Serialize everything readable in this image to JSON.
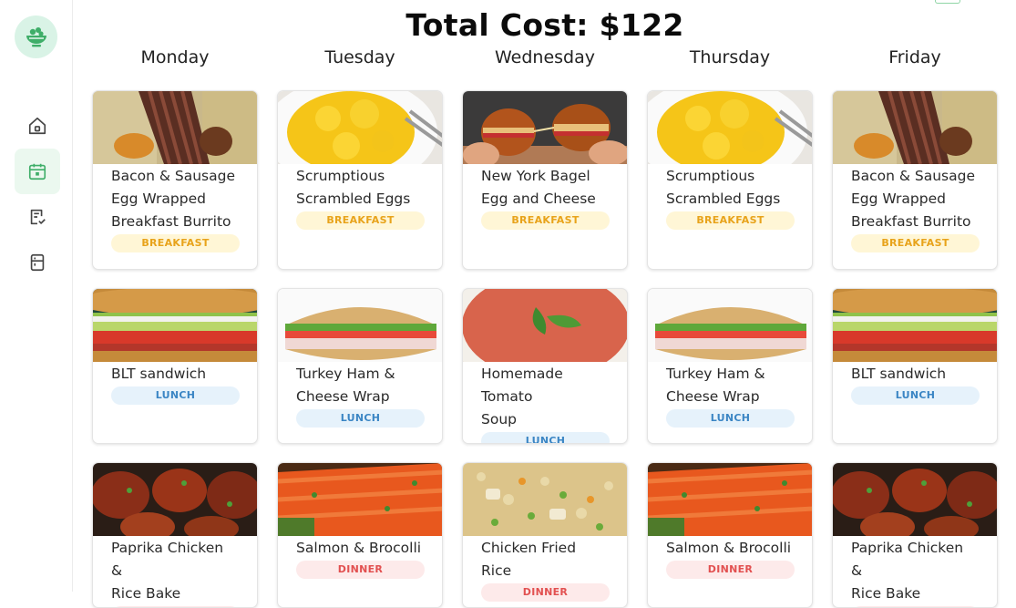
{
  "app": {
    "logo_icon": "salad-bowl-icon",
    "nav": [
      {
        "icon": "home-icon",
        "active": false
      },
      {
        "icon": "calendar-icon",
        "active": true
      },
      {
        "icon": "checklist-icon",
        "active": false
      },
      {
        "icon": "fridge-icon",
        "active": false
      }
    ]
  },
  "header": {
    "total_cost": "Total Cost: $122"
  },
  "days": [
    "Monday",
    "Tuesday",
    "Wednesday",
    "Thursday",
    "Friday"
  ],
  "meals": {
    "breakfast": [
      {
        "title_lines": [
          "Bacon & Sausage",
          "Egg Wrapped",
          "Breakfast Burrito"
        ],
        "badge": "BREAKFAST",
        "image": "burrito-image"
      },
      {
        "title_lines": [
          "Scrumptious",
          "Scrambled Eggs"
        ],
        "badge": "BREAKFAST",
        "image": "scrambled-eggs-image"
      },
      {
        "title_lines": [
          "New York Bagel",
          "Egg and Cheese"
        ],
        "badge": "BREAKFAST",
        "image": "bagel-image"
      },
      {
        "title_lines": [
          "Scrumptious",
          "Scrambled Eggs"
        ],
        "badge": "BREAKFAST",
        "image": "scrambled-eggs-image"
      },
      {
        "title_lines": [
          "Bacon & Sausage",
          "Egg Wrapped",
          "Breakfast Burrito"
        ],
        "badge": "BREAKFAST",
        "image": "burrito-image"
      }
    ],
    "lunch": [
      {
        "title_lines": [
          "BLT sandwich"
        ],
        "badge": "LUNCH",
        "image": "blt-image"
      },
      {
        "title_lines": [
          "Turkey Ham &",
          "Cheese Wrap"
        ],
        "badge": "LUNCH",
        "image": "sub-sandwich-image"
      },
      {
        "title_lines": [
          "Homemade Tomato",
          "Soup"
        ],
        "badge": "LUNCH",
        "image": "tomato-soup-image"
      },
      {
        "title_lines": [
          "Turkey Ham &",
          "Cheese Wrap"
        ],
        "badge": "LUNCH",
        "image": "sub-sandwich-image"
      },
      {
        "title_lines": [
          "BLT sandwich"
        ],
        "badge": "LUNCH",
        "image": "blt-image"
      }
    ],
    "dinner": [
      {
        "title_lines": [
          "Paprika Chicken &",
          "Rice Bake"
        ],
        "badge": "DINNER",
        "image": "paprika-chicken-image"
      },
      {
        "title_lines": [
          "Salmon & Brocolli"
        ],
        "badge": "DINNER",
        "image": "salmon-image"
      },
      {
        "title_lines": [
          "Chicken Fried Rice"
        ],
        "badge": "DINNER",
        "image": "fried-rice-image"
      },
      {
        "title_lines": [
          "Salmon & Brocolli"
        ],
        "badge": "DINNER",
        "image": "salmon-image"
      },
      {
        "title_lines": [
          "Paprika Chicken &",
          "Rice Bake"
        ],
        "badge": "DINNER",
        "image": "paprika-chicken-image"
      }
    ]
  },
  "colors": {
    "accent_green": "#3fae69",
    "breakfast_badge": "#e8a31b",
    "lunch_badge": "#3a85c4",
    "dinner_badge": "#e25050"
  }
}
